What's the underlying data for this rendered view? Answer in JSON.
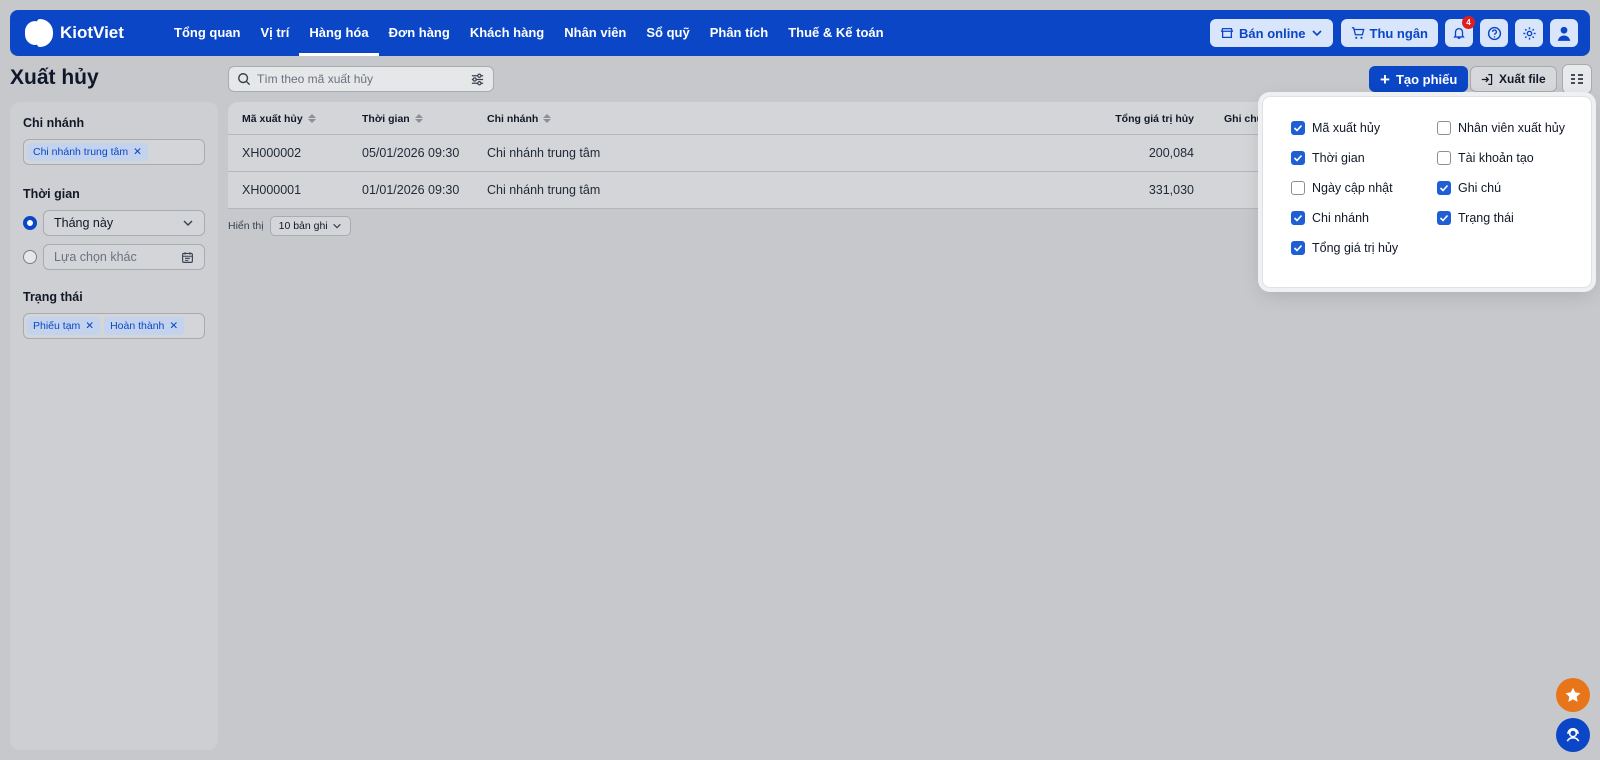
{
  "app": {
    "brand": "KiotViet"
  },
  "nav": {
    "items": [
      "Tổng quan",
      "Vị trí",
      "Hàng hóa",
      "Đơn hàng",
      "Khách hàng",
      "Nhân viên",
      "Sổ quỹ",
      "Phân tích",
      "Thuế & Kế toán"
    ],
    "active": "Hàng hóa",
    "online_label": "Bán online",
    "cashier_label": "Thu ngân",
    "notification_count": "4"
  },
  "page": {
    "title": "Xuất hủy"
  },
  "search": {
    "placeholder": "Tìm theo mã xuất hủy"
  },
  "actions": {
    "create_label": "Tạo phiếu",
    "export_label": "Xuất file"
  },
  "filters": {
    "branch_label": "Chi nhánh",
    "branch_tag": "Chi nhánh trung tâm",
    "time_label": "Thời gian",
    "time_selected": "Tháng này",
    "time_custom_placeholder": "Lựa chọn khác",
    "status_label": "Trạng thái",
    "status_tags": [
      "Phiếu tạm",
      "Hoàn thành"
    ]
  },
  "table": {
    "headers": {
      "code": "Mã xuất hủy",
      "time": "Thời gian",
      "branch": "Chi nhánh",
      "total": "Tổng giá trị hủy",
      "note": "Ghi chú"
    },
    "rows": [
      {
        "code": "XH000002",
        "time": "05/01/2026 09:30",
        "branch": "Chi nhánh trung tâm",
        "total": "200,084"
      },
      {
        "code": "XH000001",
        "time": "01/01/2026 09:30",
        "branch": "Chi nhánh trung tâm",
        "total": "331,030"
      }
    ]
  },
  "pager": {
    "show_label": "Hiển thị",
    "page_size": "10 bản ghi"
  },
  "column_panel": {
    "left": [
      {
        "label": "Mã xuất hủy",
        "checked": true
      },
      {
        "label": "Thời gian",
        "checked": true
      },
      {
        "label": "Ngày cập nhật",
        "checked": false
      },
      {
        "label": "Chi nhánh",
        "checked": true
      },
      {
        "label": "Tổng giá trị hủy",
        "checked": true
      }
    ],
    "right": [
      {
        "label": "Nhân viên xuất hủy",
        "checked": false
      },
      {
        "label": "Tài khoản tạo",
        "checked": false
      },
      {
        "label": "Ghi chú",
        "checked": true
      },
      {
        "label": "Trạng thái",
        "checked": true
      }
    ]
  },
  "colors": {
    "brand": "#0a46c6",
    "accent_orange": "#e8751a",
    "checkbox": "#1f5fd6",
    "badge": "#e11d1d"
  }
}
